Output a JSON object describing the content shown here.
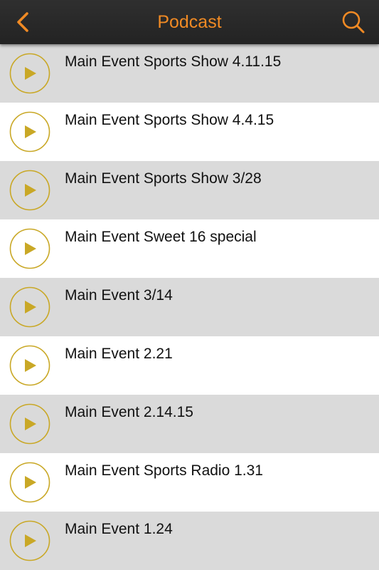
{
  "header": {
    "title": "Podcast",
    "back_icon": "chevron-left-icon",
    "search_icon": "search-icon"
  },
  "colors": {
    "accent": "#f08a24",
    "play_gold": "#c9a826",
    "header_bg": "#2b2b2b",
    "row_alt": "#dadada",
    "row_plain": "#ffffff"
  },
  "episodes": [
    {
      "title": "Main Event Sports Show 4.11.15",
      "icon": "play-icon"
    },
    {
      "title": "Main Event Sports Show 4.4.15",
      "icon": "play-icon"
    },
    {
      "title": "Main Event Sports Show 3/28",
      "icon": "play-icon"
    },
    {
      "title": "Main Event Sweet 16 special",
      "icon": "play-icon"
    },
    {
      "title": "Main Event 3/14",
      "icon": "play-icon"
    },
    {
      "title": "Main Event 2.21",
      "icon": "play-icon"
    },
    {
      "title": "Main Event 2.14.15",
      "icon": "play-icon"
    },
    {
      "title": "Main Event Sports Radio 1.31",
      "icon": "play-icon"
    },
    {
      "title": "Main Event 1.24",
      "icon": "play-icon"
    }
  ]
}
